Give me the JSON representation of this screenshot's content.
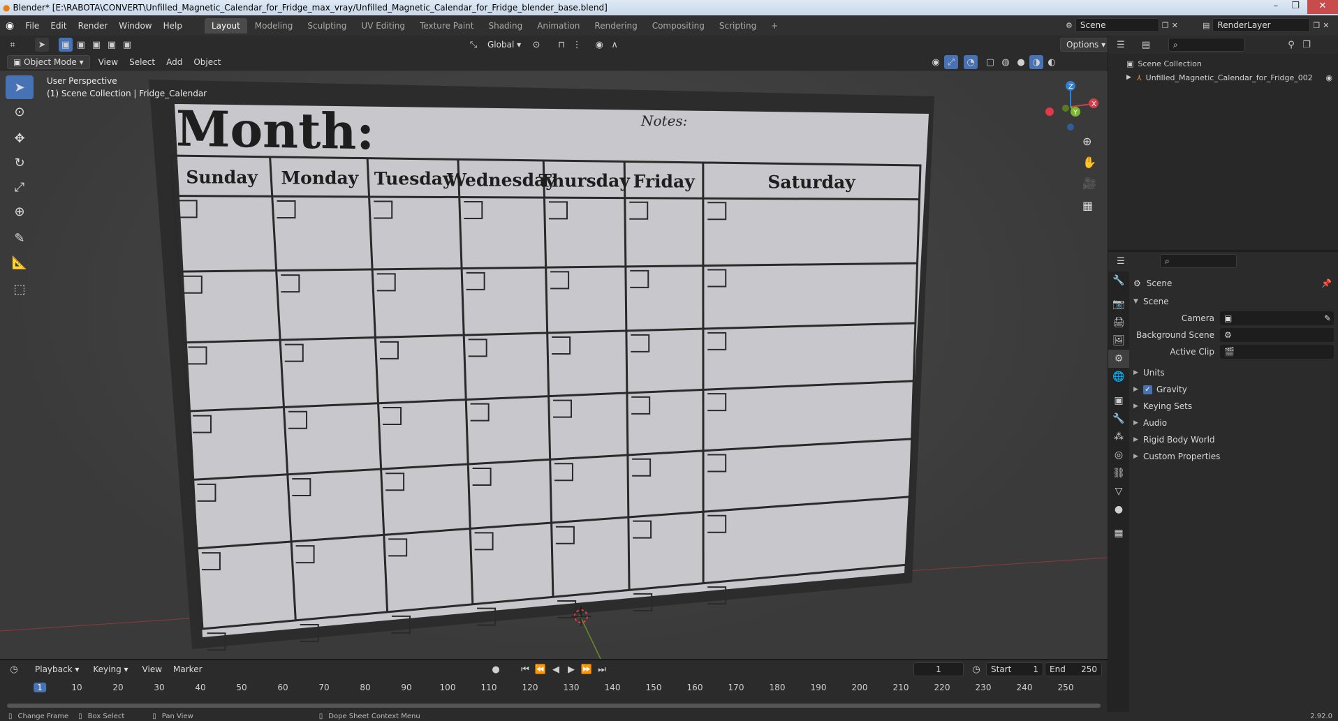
{
  "window": {
    "title": "Blender* [E:\\RABOTA\\CONVERT\\Unfilled_Magnetic_Calendar_for_Fridge_max_vray/Unfilled_Magnetic_Calendar_for_Fridge_blender_base.blend]"
  },
  "menu": [
    "File",
    "Edit",
    "Render",
    "Window",
    "Help"
  ],
  "workspaces": [
    "Layout",
    "Modeling",
    "Sculpting",
    "UV Editing",
    "Texture Paint",
    "Shading",
    "Animation",
    "Rendering",
    "Compositing",
    "Scripting"
  ],
  "active_workspace": "Layout",
  "scene_field": "Scene",
  "render_layer_field": "RenderLayer",
  "header": {
    "transform_orientation": "Global",
    "options": "Options",
    "mode": "Object Mode",
    "view_menu": [
      "View",
      "Select",
      "Add",
      "Object"
    ]
  },
  "viewport": {
    "perspective": "User Perspective",
    "collection_info": "(1) Scene Collection | Fridge_Calendar",
    "gizmo_axes": {
      "z": "Z",
      "y": "Y",
      "x": "X"
    }
  },
  "calendar": {
    "month_label": "Month:",
    "notes_label": "Notes:",
    "days": [
      "Sunday",
      "Monday",
      "Tuesday",
      "Wednesday",
      "Thursday",
      "Friday",
      "Saturday"
    ]
  },
  "outliner": {
    "root": "Scene Collection",
    "items": [
      "Unfilled_Magnetic_Calendar_for_Fridge_002"
    ]
  },
  "properties": {
    "breadcrumb": "Scene",
    "section": "Scene",
    "camera_label": "Camera",
    "background_scene_label": "Background Scene",
    "active_clip_label": "Active Clip",
    "panels": [
      "Units",
      "Gravity",
      "Keying Sets",
      "Audio",
      "Rigid Body World",
      "Custom Properties"
    ],
    "gravity_checked": true
  },
  "timeline": {
    "menus": [
      "Playback",
      "Keying",
      "View",
      "Marker"
    ],
    "current_frame": "1",
    "start_label": "Start",
    "start": "1",
    "end_label": "End",
    "end": "250",
    "ticks": [
      "1",
      "10",
      "20",
      "30",
      "40",
      "50",
      "60",
      "70",
      "80",
      "90",
      "100",
      "110",
      "120",
      "130",
      "140",
      "150",
      "160",
      "170",
      "180",
      "190",
      "200",
      "210",
      "220",
      "230",
      "240",
      "250"
    ]
  },
  "status": {
    "items": [
      "Change Frame",
      "Box Select",
      "Pan View",
      "Dope Sheet Context Menu"
    ],
    "version": "2.92.0"
  },
  "colors": {
    "accent": "#4772b3",
    "axis_x": "#d23e4b",
    "axis_y": "#7ab82c",
    "axis_z": "#2f7fd6"
  }
}
